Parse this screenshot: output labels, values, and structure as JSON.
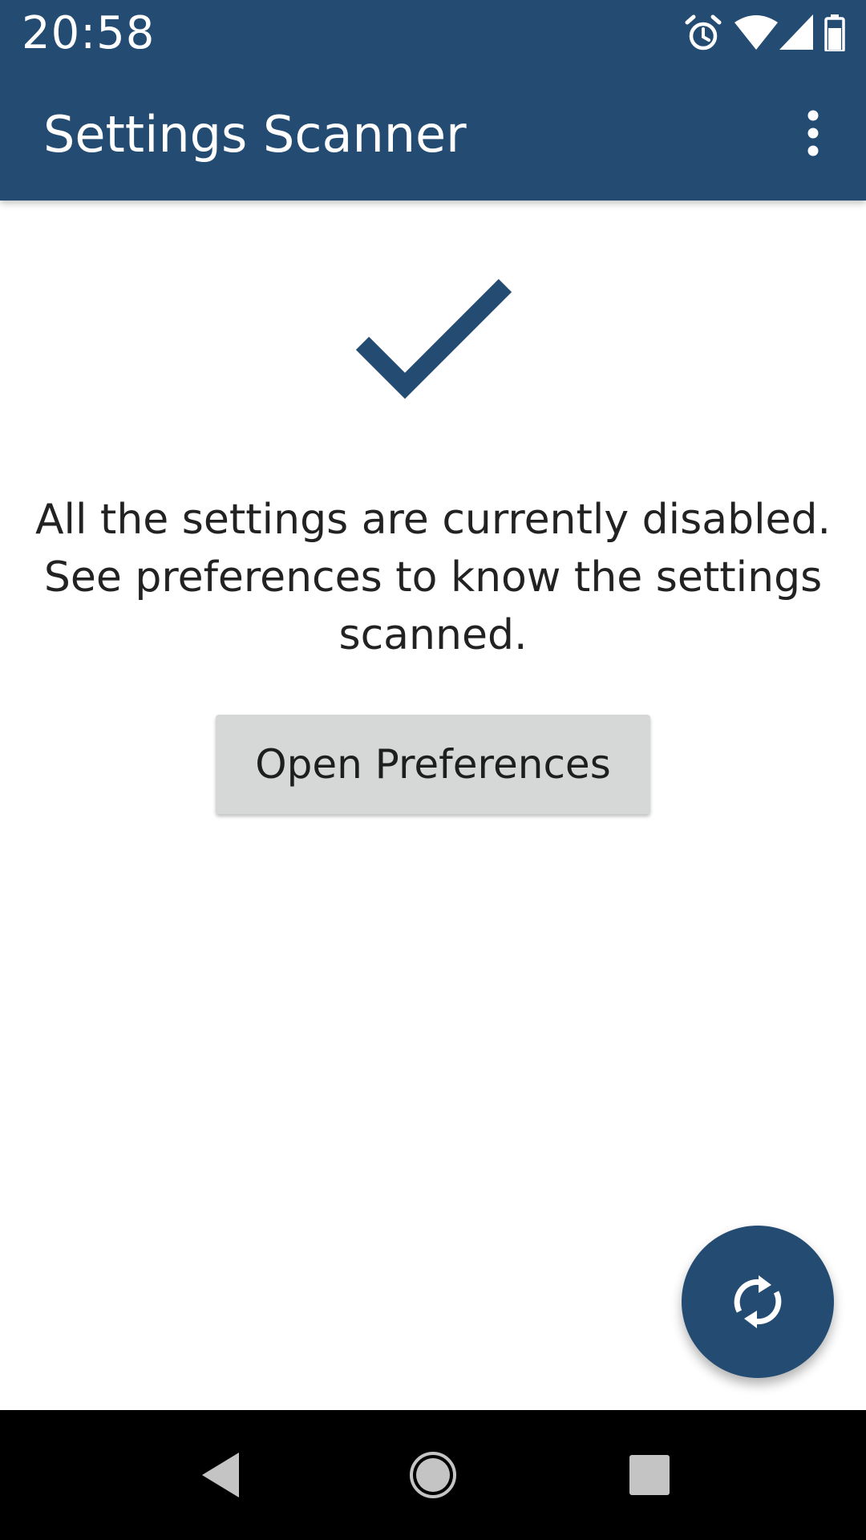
{
  "status_bar": {
    "time": "20:58",
    "icons": [
      "alarm-icon",
      "wifi-icon",
      "cell-signal-icon",
      "battery-icon"
    ]
  },
  "toolbar": {
    "title": "Settings Scanner",
    "overflow_icon": "more-vert-icon"
  },
  "main": {
    "status_icon": "check-icon",
    "message": "All the settings are currently disabled. See preferences to know the settings scanned.",
    "button_label": "Open Preferences"
  },
  "fab": {
    "icon": "refresh-icon"
  },
  "nav_bar": {
    "icons": [
      "back-icon",
      "home-icon",
      "recents-icon"
    ]
  },
  "colors": {
    "primary": "#244b72",
    "button_background": "#d6d7d7",
    "text": "#222222",
    "nav_background": "#000000"
  }
}
